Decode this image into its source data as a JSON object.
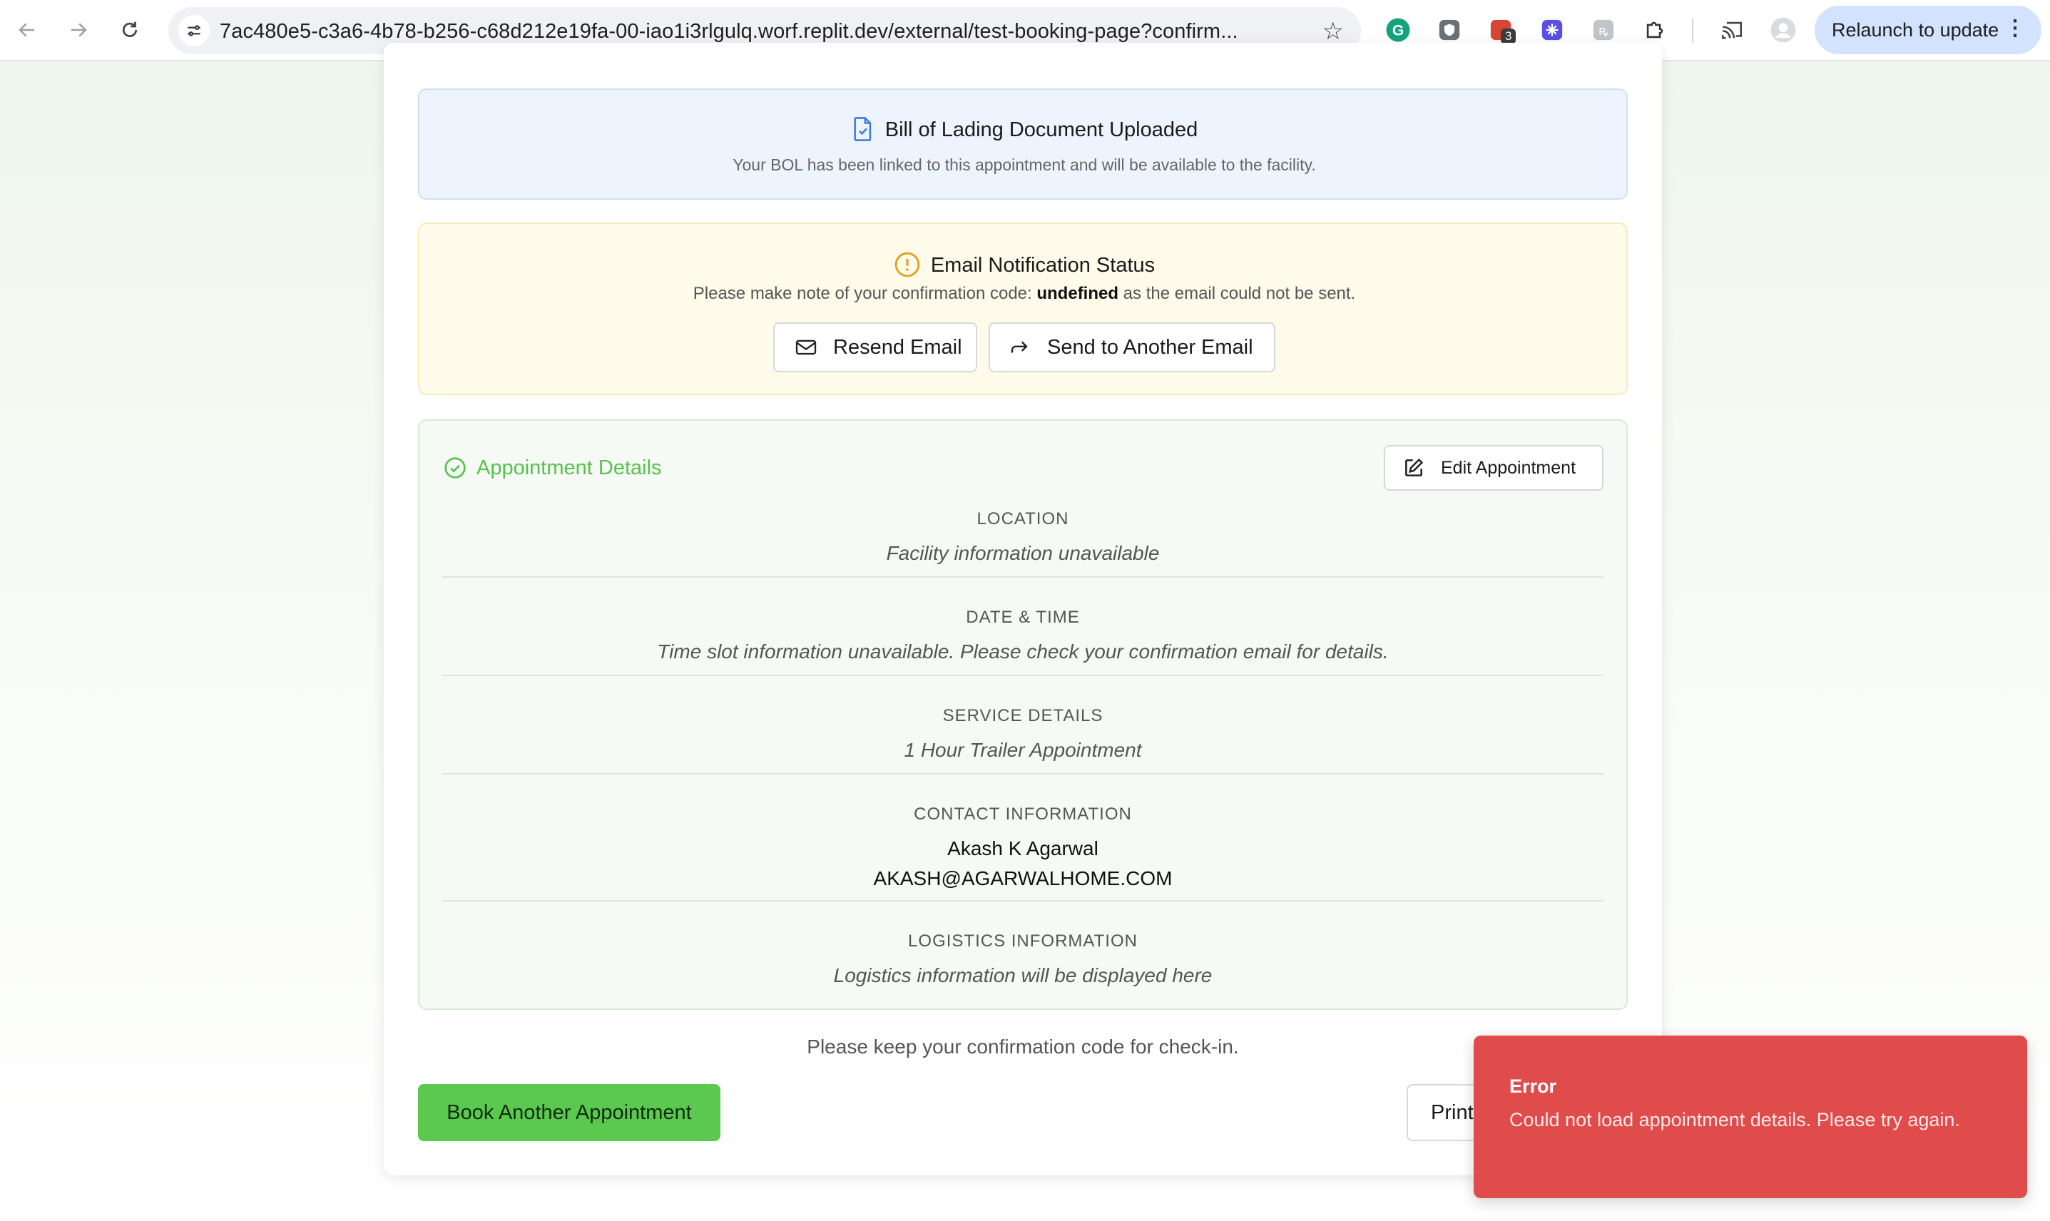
{
  "browser": {
    "url": "7ac480e5-c3a6-4b78-b256-c68d212e19fa-00-iao1i3rlgulq.worf.replit.dev/external/test-booking-page?confirm...",
    "relaunch_label": "Relaunch to update",
    "extension_badge": "3"
  },
  "bol": {
    "title": "Bill of Lading Document Uploaded",
    "subtitle": "Your BOL has been linked to this appointment and will be available to the facility."
  },
  "email_status": {
    "title": "Email Notification Status",
    "message_prefix": "Please make note of your confirmation code: ",
    "code": "undefined",
    "message_suffix": " as the email could not be sent.",
    "resend_label": "Resend Email",
    "send_another_label": "Send to Another Email"
  },
  "details": {
    "title": "Appointment Details",
    "edit_label": "Edit Appointment",
    "location_label": "LOCATION",
    "location_value": "Facility information unavailable",
    "datetime_label": "DATE & TIME",
    "datetime_value": "Time slot information unavailable. Please check your confirmation email for details.",
    "service_label": "SERVICE DETAILS",
    "service_value": "1 Hour Trailer Appointment",
    "contact_label": "CONTACT INFORMATION",
    "contact_name": "Akash K Agarwal",
    "contact_email": "AKASH@AGARWALHOME.COM",
    "logistics_label": "LOGISTICS INFORMATION",
    "logistics_value": "Logistics information will be displayed here"
  },
  "footer": {
    "note": "Please keep your confirmation code for check-in.",
    "book_another_label": "Book Another Appointment",
    "print_label": "Print"
  },
  "toast": {
    "title": "Error",
    "message": "Could not load appointment details. Please try again."
  },
  "colors": {
    "success_green": "#5bc94f",
    "error_red": "#e04b4b",
    "info_blue_bg": "#eef4fd",
    "warning_yellow_bg": "#fefbea"
  }
}
